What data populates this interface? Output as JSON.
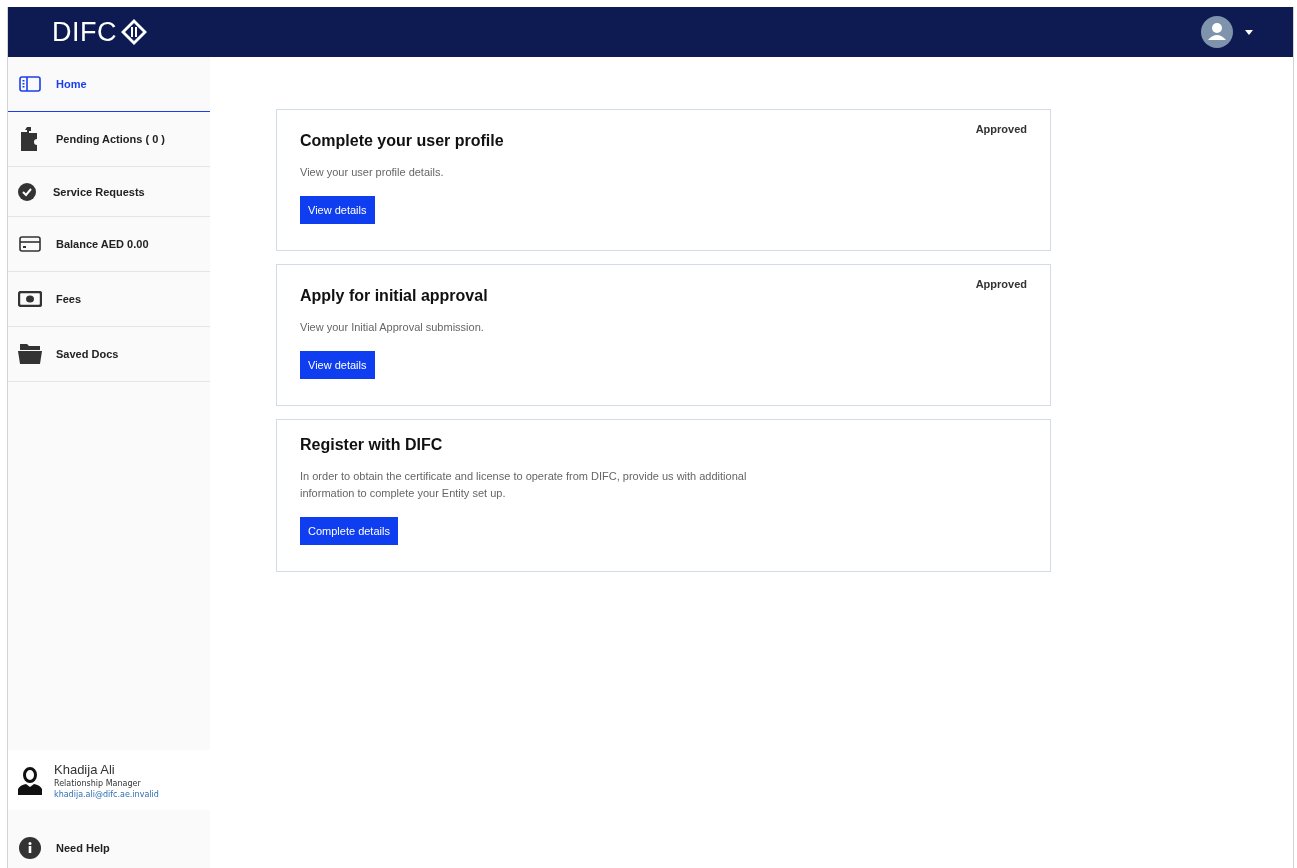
{
  "header": {
    "logo": "DIFC"
  },
  "sidebar": {
    "items": [
      {
        "label": "Home",
        "selected": true
      },
      {
        "label": "Pending Actions ( 0 )",
        "selected": false
      },
      {
        "label": "Service Requests",
        "selected": false
      },
      {
        "label": "Balance AED 0.00",
        "selected": false
      },
      {
        "label": "Fees",
        "selected": false
      },
      {
        "label": "Saved Docs",
        "selected": false
      }
    ],
    "manager": {
      "name": "Khadija Ali",
      "role": "Relationship Manager",
      "email": "khadija.ali@difc.ae.invalid"
    },
    "help": "Need Help"
  },
  "cards": [
    {
      "title": "Complete your user profile",
      "status": "Approved",
      "description": "View your user profile details.",
      "button": "View details"
    },
    {
      "title": "Apply for initial approval",
      "status": "Approved",
      "description": "View your Initial Approval submission.",
      "button": "View details"
    },
    {
      "title": "Register with DIFC",
      "description": "In order to obtain the certificate and license to operate from DIFC, provide us with additional information to complete your Entity set up.",
      "button": "Complete details"
    }
  ]
}
